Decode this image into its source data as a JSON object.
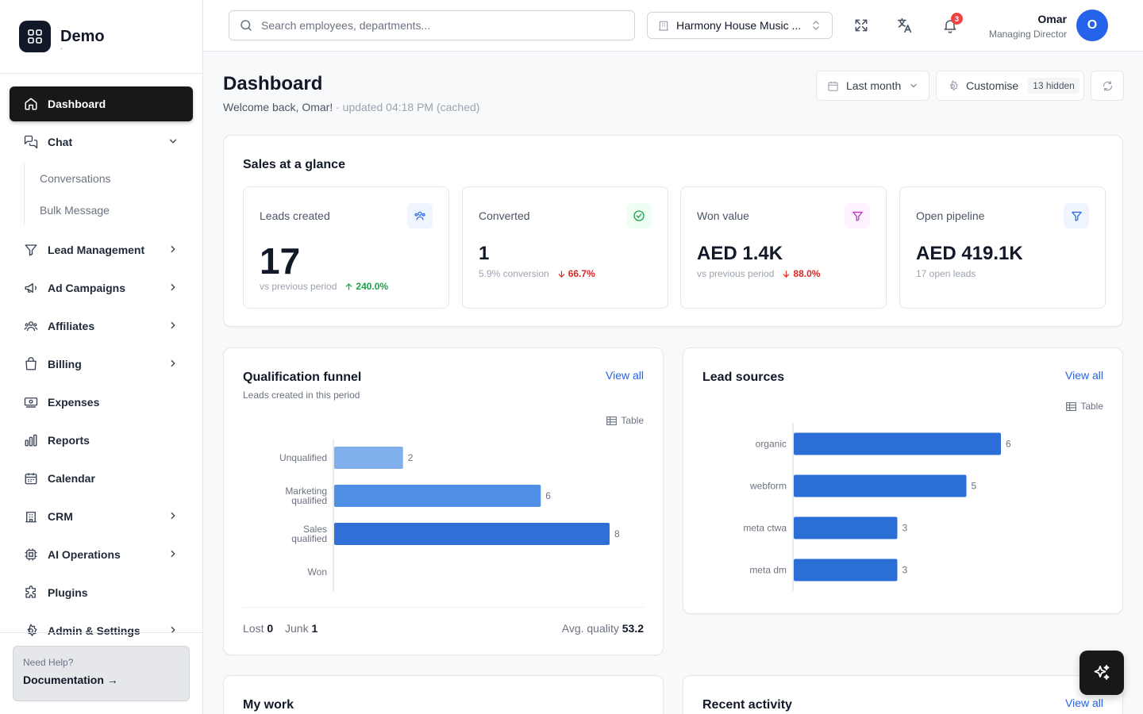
{
  "brand": {
    "name": "Demo",
    "tagline": "."
  },
  "sidebar": {
    "items": [
      {
        "label": "Dashboard",
        "icon": "home-icon",
        "active": true
      },
      {
        "label": "Chat",
        "icon": "chat-icon",
        "expanded": true,
        "children": [
          "Conversations",
          "Bulk Message"
        ]
      },
      {
        "label": "Lead Management",
        "icon": "filter-icon",
        "chevron": true
      },
      {
        "label": "Ad Campaigns",
        "icon": "megaphone-icon",
        "chevron": true
      },
      {
        "label": "Affiliates",
        "icon": "users-icon",
        "chevron": true
      },
      {
        "label": "Billing",
        "icon": "shopping-bag-icon",
        "chevron": true
      },
      {
        "label": "Expenses",
        "icon": "banknote-icon"
      },
      {
        "label": "Reports",
        "icon": "bar-chart-icon"
      },
      {
        "label": "Calendar",
        "icon": "calendar-icon"
      },
      {
        "label": "CRM",
        "icon": "building-icon",
        "chevron": true
      },
      {
        "label": "AI Operations",
        "icon": "cpu-icon",
        "chevron": true
      },
      {
        "label": "Plugins",
        "icon": "puzzle-icon"
      },
      {
        "label": "Admin & Settings",
        "icon": "gear-icon",
        "chevron": true
      }
    ],
    "help": {
      "label": "Need Help?",
      "link": "Documentation →"
    }
  },
  "header": {
    "search_placeholder": "Search employees, departments...",
    "org": "Harmony House Music ...",
    "notifications": "3",
    "user": {
      "name": "Omar",
      "role": "Managing Director",
      "initial": "O"
    }
  },
  "page": {
    "title": "Dashboard",
    "welcome": "Welcome back, Omar!",
    "updated": " · updated 04:18 PM (cached)",
    "period": "Last month",
    "customise": "Customise",
    "hidden": "13 hidden"
  },
  "sales": {
    "title": "Sales at a glance",
    "kpis": [
      {
        "label": "Leads created",
        "value": "17",
        "foot": "vs previous period",
        "delta": "240.0%",
        "dir": "up",
        "icon": "users-icon",
        "icon_color": "#2563eb",
        "icon_bg": "#eff6ff"
      },
      {
        "label": "Converted",
        "value": "1",
        "foot": "5.9% conversion",
        "delta": "66.7%",
        "dir": "down",
        "icon": "check-circle-icon",
        "icon_color": "#16a34a",
        "icon_bg": "#f0fdf4"
      },
      {
        "label": "Won value",
        "value": "AED 1.4K",
        "foot": "vs previous period",
        "delta": "88.0%",
        "dir": "down",
        "icon": "filter-icon",
        "icon_color": "#c026d3",
        "icon_bg": "#fdf4ff"
      },
      {
        "label": "Open pipeline",
        "value": "AED 419.1K",
        "foot": "17 open leads",
        "icon": "filter-icon",
        "icon_color": "#2563eb",
        "icon_bg": "#eff6ff"
      }
    ]
  },
  "funnel": {
    "title": "Qualification funnel",
    "subtitle": "Leads created in this period",
    "view_all": "View all",
    "table": "Table",
    "lost_label": "Lost",
    "lost": "0",
    "junk_label": "Junk",
    "junk": "1",
    "quality_label": "Avg. quality",
    "quality": "53.2"
  },
  "sources": {
    "title": "Lead sources",
    "view_all": "View all",
    "table": "Table"
  },
  "my_work": {
    "title": "My work"
  },
  "activity": {
    "title": "Recent activity",
    "view_all": "View all"
  },
  "chart_data": [
    {
      "type": "bar",
      "orientation": "horizontal",
      "categories": [
        "Unqualified",
        "Marketing qualified",
        "Sales qualified",
        "Won"
      ],
      "values": [
        2,
        6,
        8,
        0
      ],
      "colors": [
        "#7fb0ec",
        "#4f90e6",
        "#2f6fd6",
        "#2f6fd6"
      ],
      "xlim": [
        0,
        8
      ]
    },
    {
      "type": "bar",
      "orientation": "horizontal",
      "categories": [
        "organic",
        "webform",
        "meta ctwa",
        "meta dm"
      ],
      "values": [
        6,
        5,
        3,
        3
      ],
      "colors": [
        "#2b6fd6"
      ],
      "xlim": [
        0,
        6
      ]
    }
  ]
}
